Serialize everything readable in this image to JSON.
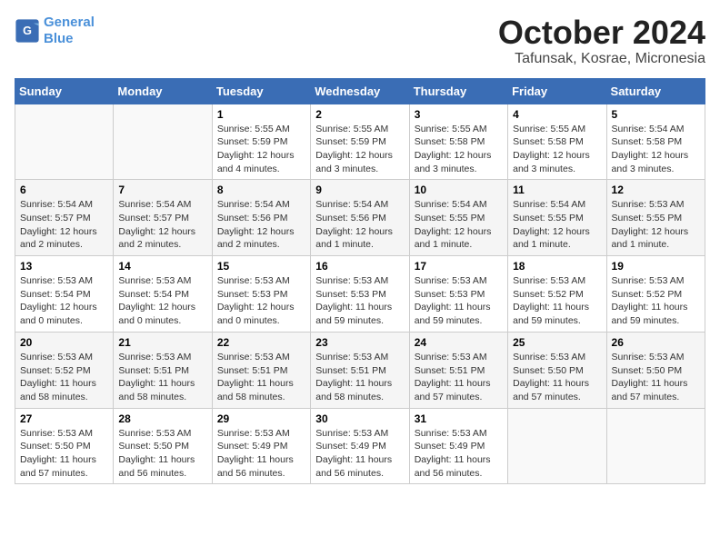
{
  "logo": {
    "line1": "General",
    "line2": "Blue"
  },
  "title": "October 2024",
  "location": "Tafunsak, Kosrae, Micronesia",
  "days_header": [
    "Sunday",
    "Monday",
    "Tuesday",
    "Wednesday",
    "Thursday",
    "Friday",
    "Saturday"
  ],
  "weeks": [
    [
      {
        "day": "",
        "info": ""
      },
      {
        "day": "",
        "info": ""
      },
      {
        "day": "1",
        "info": "Sunrise: 5:55 AM\nSunset: 5:59 PM\nDaylight: 12 hours and 4 minutes."
      },
      {
        "day": "2",
        "info": "Sunrise: 5:55 AM\nSunset: 5:59 PM\nDaylight: 12 hours and 3 minutes."
      },
      {
        "day": "3",
        "info": "Sunrise: 5:55 AM\nSunset: 5:58 PM\nDaylight: 12 hours and 3 minutes."
      },
      {
        "day": "4",
        "info": "Sunrise: 5:55 AM\nSunset: 5:58 PM\nDaylight: 12 hours and 3 minutes."
      },
      {
        "day": "5",
        "info": "Sunrise: 5:54 AM\nSunset: 5:58 PM\nDaylight: 12 hours and 3 minutes."
      }
    ],
    [
      {
        "day": "6",
        "info": "Sunrise: 5:54 AM\nSunset: 5:57 PM\nDaylight: 12 hours and 2 minutes."
      },
      {
        "day": "7",
        "info": "Sunrise: 5:54 AM\nSunset: 5:57 PM\nDaylight: 12 hours and 2 minutes."
      },
      {
        "day": "8",
        "info": "Sunrise: 5:54 AM\nSunset: 5:56 PM\nDaylight: 12 hours and 2 minutes."
      },
      {
        "day": "9",
        "info": "Sunrise: 5:54 AM\nSunset: 5:56 PM\nDaylight: 12 hours and 1 minute."
      },
      {
        "day": "10",
        "info": "Sunrise: 5:54 AM\nSunset: 5:55 PM\nDaylight: 12 hours and 1 minute."
      },
      {
        "day": "11",
        "info": "Sunrise: 5:54 AM\nSunset: 5:55 PM\nDaylight: 12 hours and 1 minute."
      },
      {
        "day": "12",
        "info": "Sunrise: 5:53 AM\nSunset: 5:55 PM\nDaylight: 12 hours and 1 minute."
      }
    ],
    [
      {
        "day": "13",
        "info": "Sunrise: 5:53 AM\nSunset: 5:54 PM\nDaylight: 12 hours and 0 minutes."
      },
      {
        "day": "14",
        "info": "Sunrise: 5:53 AM\nSunset: 5:54 PM\nDaylight: 12 hours and 0 minutes."
      },
      {
        "day": "15",
        "info": "Sunrise: 5:53 AM\nSunset: 5:53 PM\nDaylight: 12 hours and 0 minutes."
      },
      {
        "day": "16",
        "info": "Sunrise: 5:53 AM\nSunset: 5:53 PM\nDaylight: 11 hours and 59 minutes."
      },
      {
        "day": "17",
        "info": "Sunrise: 5:53 AM\nSunset: 5:53 PM\nDaylight: 11 hours and 59 minutes."
      },
      {
        "day": "18",
        "info": "Sunrise: 5:53 AM\nSunset: 5:52 PM\nDaylight: 11 hours and 59 minutes."
      },
      {
        "day": "19",
        "info": "Sunrise: 5:53 AM\nSunset: 5:52 PM\nDaylight: 11 hours and 59 minutes."
      }
    ],
    [
      {
        "day": "20",
        "info": "Sunrise: 5:53 AM\nSunset: 5:52 PM\nDaylight: 11 hours and 58 minutes."
      },
      {
        "day": "21",
        "info": "Sunrise: 5:53 AM\nSunset: 5:51 PM\nDaylight: 11 hours and 58 minutes."
      },
      {
        "day": "22",
        "info": "Sunrise: 5:53 AM\nSunset: 5:51 PM\nDaylight: 11 hours and 58 minutes."
      },
      {
        "day": "23",
        "info": "Sunrise: 5:53 AM\nSunset: 5:51 PM\nDaylight: 11 hours and 58 minutes."
      },
      {
        "day": "24",
        "info": "Sunrise: 5:53 AM\nSunset: 5:51 PM\nDaylight: 11 hours and 57 minutes."
      },
      {
        "day": "25",
        "info": "Sunrise: 5:53 AM\nSunset: 5:50 PM\nDaylight: 11 hours and 57 minutes."
      },
      {
        "day": "26",
        "info": "Sunrise: 5:53 AM\nSunset: 5:50 PM\nDaylight: 11 hours and 57 minutes."
      }
    ],
    [
      {
        "day": "27",
        "info": "Sunrise: 5:53 AM\nSunset: 5:50 PM\nDaylight: 11 hours and 57 minutes."
      },
      {
        "day": "28",
        "info": "Sunrise: 5:53 AM\nSunset: 5:50 PM\nDaylight: 11 hours and 56 minutes."
      },
      {
        "day": "29",
        "info": "Sunrise: 5:53 AM\nSunset: 5:49 PM\nDaylight: 11 hours and 56 minutes."
      },
      {
        "day": "30",
        "info": "Sunrise: 5:53 AM\nSunset: 5:49 PM\nDaylight: 11 hours and 56 minutes."
      },
      {
        "day": "31",
        "info": "Sunrise: 5:53 AM\nSunset: 5:49 PM\nDaylight: 11 hours and 56 minutes."
      },
      {
        "day": "",
        "info": ""
      },
      {
        "day": "",
        "info": ""
      }
    ]
  ]
}
